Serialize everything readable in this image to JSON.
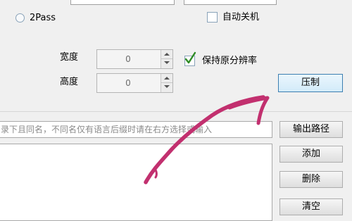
{
  "encode": {
    "twopass_label": "2Pass",
    "auto_shutdown_label": "自动关机"
  },
  "size": {
    "width_label": "宽度",
    "width_value": "0",
    "height_label": "高度",
    "height_value": "0",
    "keep_resolution_label": "保持原分辨率",
    "keep_resolution_checked": true
  },
  "actions": {
    "compress_label": "压制",
    "output_path_label": "输出路径",
    "add_label": "添加",
    "delete_label": "删除",
    "clear_label": "清空"
  },
  "subtitle": {
    "path_hint": "录下且同名，不同名仅有语言后缀时请在右方选择或输入"
  },
  "colors": {
    "accent_border": "#3c7fb1",
    "annotation_stroke": "#c2306f"
  },
  "annotation": {
    "icon": "hand-drawn-arrow-icon"
  }
}
